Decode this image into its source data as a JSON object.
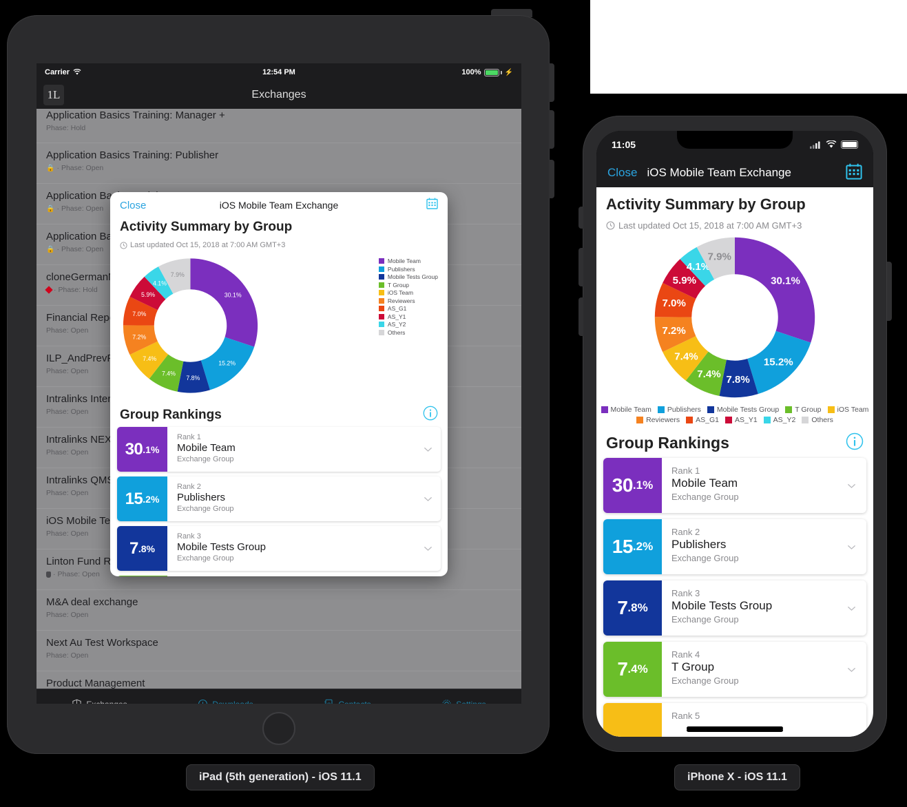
{
  "ipad": {
    "device_label": "iPad (5th generation) - iOS 11.1",
    "status": {
      "carrier": "Carrier",
      "time": "12:54 PM",
      "battery": "100%"
    },
    "nav": {
      "brand": "1L",
      "title": "Exchanges"
    },
    "exchanges": [
      {
        "title": "Application Basics Training: Manager +",
        "phase": "Phase: Hold",
        "marker": "none"
      },
      {
        "title": "Application Basics Training: Publisher",
        "phase": "Phase: Open",
        "marker": "lock"
      },
      {
        "title": "Application Basics Training: Q&A",
        "phase": "Phase: Open",
        "marker": "lock"
      },
      {
        "title": "Application Ba",
        "phase": "Phase: Open",
        "marker": "lock"
      },
      {
        "title": "cloneGermanN",
        "phase": "Phase: Hold",
        "marker": "diamond"
      },
      {
        "title": "Financial Repo",
        "phase": "Phase: Open",
        "marker": "none"
      },
      {
        "title": "ILP_AndPrevF",
        "phase": "Phase: Open",
        "marker": "none"
      },
      {
        "title": "Intralinks Inter",
        "phase": "Phase: Open",
        "marker": "none"
      },
      {
        "title": "Intralinks NEX",
        "phase": "Phase: Open",
        "marker": "none"
      },
      {
        "title": "Intralinks QMS",
        "phase": "Phase: Open",
        "marker": "none"
      },
      {
        "title": "iOS Mobile Te",
        "phase": "Phase: Open",
        "marker": "none"
      },
      {
        "title": "Linton Fund R",
        "phase": "Phase: Open",
        "marker": "shield"
      },
      {
        "title": "M&A deal exchange",
        "phase": "Phase: Open",
        "marker": "none"
      },
      {
        "title": "Next Au Test Workspace",
        "phase": "Phase: Open",
        "marker": "none"
      },
      {
        "title": "Product Management",
        "phase": "",
        "marker": "none"
      }
    ],
    "tabs": [
      {
        "label": "Exchanges",
        "icon": "box-icon",
        "active": true
      },
      {
        "label": "Downloads",
        "icon": "download-cloud-icon",
        "active": false
      },
      {
        "label": "Contacts",
        "icon": "contacts-icon",
        "active": false
      },
      {
        "label": "Settings",
        "icon": "gear-icon",
        "active": false
      }
    ]
  },
  "iphone": {
    "device_label": "iPhone X - iOS 11.1",
    "status": {
      "time": "11:05"
    }
  },
  "modal": {
    "close_label": "Close",
    "title": "iOS Mobile Team Exchange",
    "calendar_icon": "calendar-icon",
    "heading": "Activity Summary by Group",
    "last_updated": "Last updated Oct 15, 2018 at 7:00 AM GMT+3",
    "clock_icon": "clock-icon",
    "rankings_title": "Group Rankings",
    "info_icon": "info-icon",
    "chevron_icon": "chevron-down-icon",
    "group_subtitle": "Exchange Group",
    "rankings": [
      {
        "rank": "Rank 1",
        "name": "Mobile Team",
        "whole": "30",
        "frac": ".1%",
        "color": "#7B2FBE"
      },
      {
        "rank": "Rank 2",
        "name": "Publishers",
        "whole": "15",
        "frac": ".2%",
        "color": "#10A0DC"
      },
      {
        "rank": "Rank 3",
        "name": "Mobile Tests Group",
        "whole": "7",
        "frac": ".8%",
        "color": "#12369B"
      },
      {
        "rank": "Rank 4",
        "name": "T Group",
        "whole": "7",
        "frac": ".4%",
        "color": "#6BBE2A"
      },
      {
        "rank": "Rank 5",
        "name": "",
        "whole": "",
        "frac": "",
        "color": "#F7BE16"
      }
    ]
  },
  "chart_data": {
    "type": "pie",
    "title": "Activity Summary by Group",
    "donut": true,
    "legend_position": "right",
    "categories": [
      "Mobile Team",
      "Publishers",
      "Mobile Tests Group",
      "T Group",
      "iOS Team",
      "Reviewers",
      "AS_G1",
      "AS_Y1",
      "AS_Y2",
      "Others"
    ],
    "values": [
      30.1,
      15.2,
      7.8,
      7.4,
      7.4,
      7.2,
      7.0,
      5.9,
      4.1,
      7.9
    ],
    "labels": [
      "30.1%",
      "15.2%",
      "7.8%",
      "7.4%",
      "7.4%",
      "7.2%",
      "7.0%",
      "5.9%",
      "4.1%",
      "7.9%"
    ],
    "colors": [
      "#7B2FBE",
      "#10A0DC",
      "#12369B",
      "#6BBE2A",
      "#F7BE16",
      "#F58220",
      "#EA4713",
      "#CC0B38",
      "#3AD6E8",
      "#D6D6D8"
    ]
  }
}
